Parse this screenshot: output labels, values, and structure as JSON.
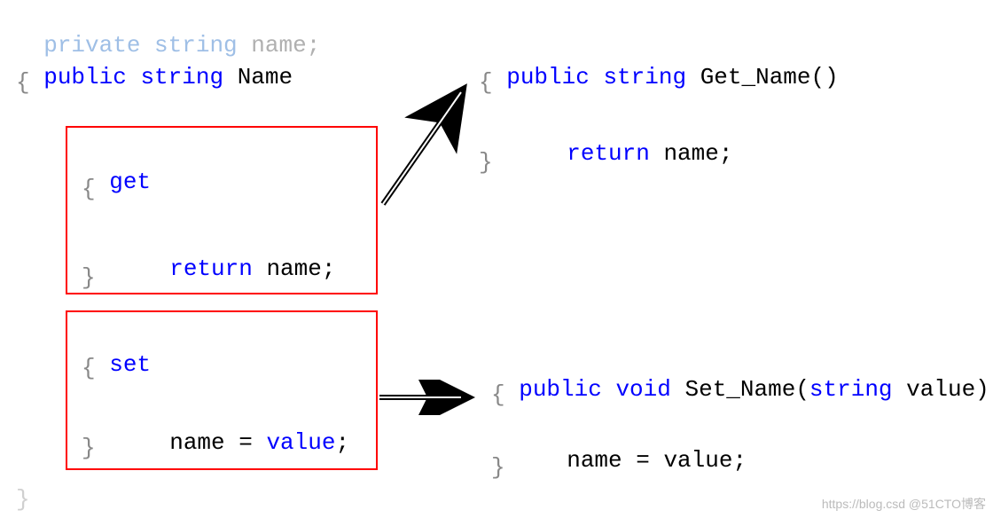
{
  "left": {
    "field_decl": {
      "kw_private": "private",
      "kw_string": "string",
      "name": "name",
      "semi": ";"
    },
    "property_decl": {
      "kw_public": "public",
      "kw_string": "string",
      "name": "Name"
    },
    "get_block": {
      "kw_get": "get",
      "kw_return": "return",
      "ident": "name",
      "semi": ";"
    },
    "set_block": {
      "kw_set": "set",
      "lhs": "name",
      "eq": " = ",
      "rhs": "value",
      "semi": ";"
    }
  },
  "right": {
    "getter": {
      "kw_public": "public",
      "kw_string": "string",
      "fn": "Get_Name",
      "params": "()",
      "kw_return": "return",
      "ident": "name",
      "semi": ";"
    },
    "setter": {
      "kw_public": "public",
      "kw_void": "void",
      "fn": "Set_Name",
      "kw_paramtype": "string",
      "param": "value",
      "lhs": "name",
      "eq": " = ",
      "rhs": "value",
      "semi": ";"
    }
  },
  "watermark": "https://blog.csd @51CTO博客"
}
